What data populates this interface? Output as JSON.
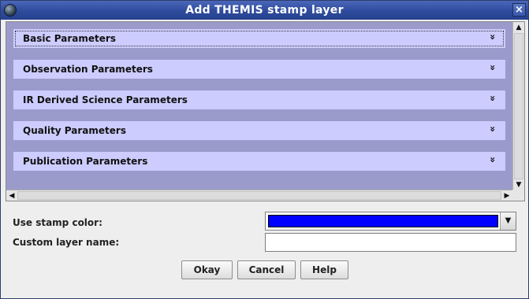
{
  "window": {
    "title": "Add THEMIS stamp layer",
    "close_glyph": "×"
  },
  "sections": [
    {
      "label": "Basic Parameters",
      "chevron": "»"
    },
    {
      "label": "Observation Parameters",
      "chevron": "»"
    },
    {
      "label": "IR Derived Science Parameters",
      "chevron": "»"
    },
    {
      "label": "Quality Parameters",
      "chevron": "»"
    },
    {
      "label": "Publication Parameters",
      "chevron": "»"
    }
  ],
  "scroll": {
    "up": "▲",
    "down": "▼",
    "left": "◀",
    "right": "▶"
  },
  "form": {
    "color_label": "Use stamp color:",
    "color_value": "#0000ff",
    "color_arrow": "▼",
    "name_label": "Custom layer name:",
    "name_value": ""
  },
  "buttons": {
    "okay": "Okay",
    "cancel": "Cancel",
    "help": "Help"
  },
  "colors": {
    "title_bar": "#2e4b9d",
    "panel_bg": "#9b9bcb",
    "section_bg": "#ccccff",
    "stamp_color": "#0000ff"
  }
}
